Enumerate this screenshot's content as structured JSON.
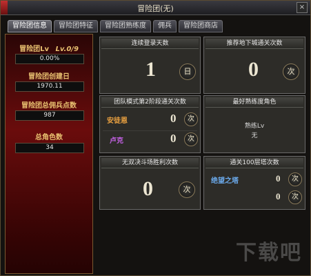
{
  "window": {
    "title": "冒险团(无)",
    "close_label": "×"
  },
  "tabs": [
    "冒险团信息",
    "冒险团特征",
    "冒险团熟练度",
    "佣兵",
    "冒险团商店"
  ],
  "left_panel": {
    "level_label": "冒险团Lv",
    "level_value": "Lv.0/9",
    "level_progress": "0.00%",
    "created_label": "冒险团创建日",
    "created_value": "1970.11",
    "mercenary_label": "冒险团总佣兵点数",
    "mercenary_value": "987",
    "char_count_label": "总角色数",
    "char_count_value": "34"
  },
  "panels": {
    "login_days": {
      "title": "连续登录天数",
      "value": "1",
      "unit": "日"
    },
    "dungeon_clears": {
      "title": "推荐地下城通关次数",
      "value": "0",
      "unit": "次"
    },
    "team_mode": {
      "title": "团队模式第2阶段通关次数",
      "rows": [
        {
          "name": "安徒恩",
          "value": "0",
          "unit": "次",
          "color": "#e8a040"
        },
        {
          "name": "卢克",
          "value": "0",
          "unit": "次",
          "color": "#c060e0"
        }
      ]
    },
    "best_character": {
      "title": "最好熟练度角色",
      "line1": "熟练Lv",
      "line2": "无"
    },
    "wushuang": {
      "title": "无双决斗场胜利次数",
      "value": "0",
      "unit": "次"
    },
    "clear100": {
      "title": "通关100层塔次数",
      "rows": [
        {
          "name": "绝望之塔",
          "value": "0",
          "unit": "次",
          "color": "#6aa8e8"
        },
        {
          "name": "",
          "value": "0",
          "unit": "次"
        }
      ]
    }
  },
  "watermark": "下载吧",
  "colors": {
    "accent_gold": "#e8c070",
    "panel_bg": "#2d2c28",
    "left_red": "#6a0c0c"
  }
}
